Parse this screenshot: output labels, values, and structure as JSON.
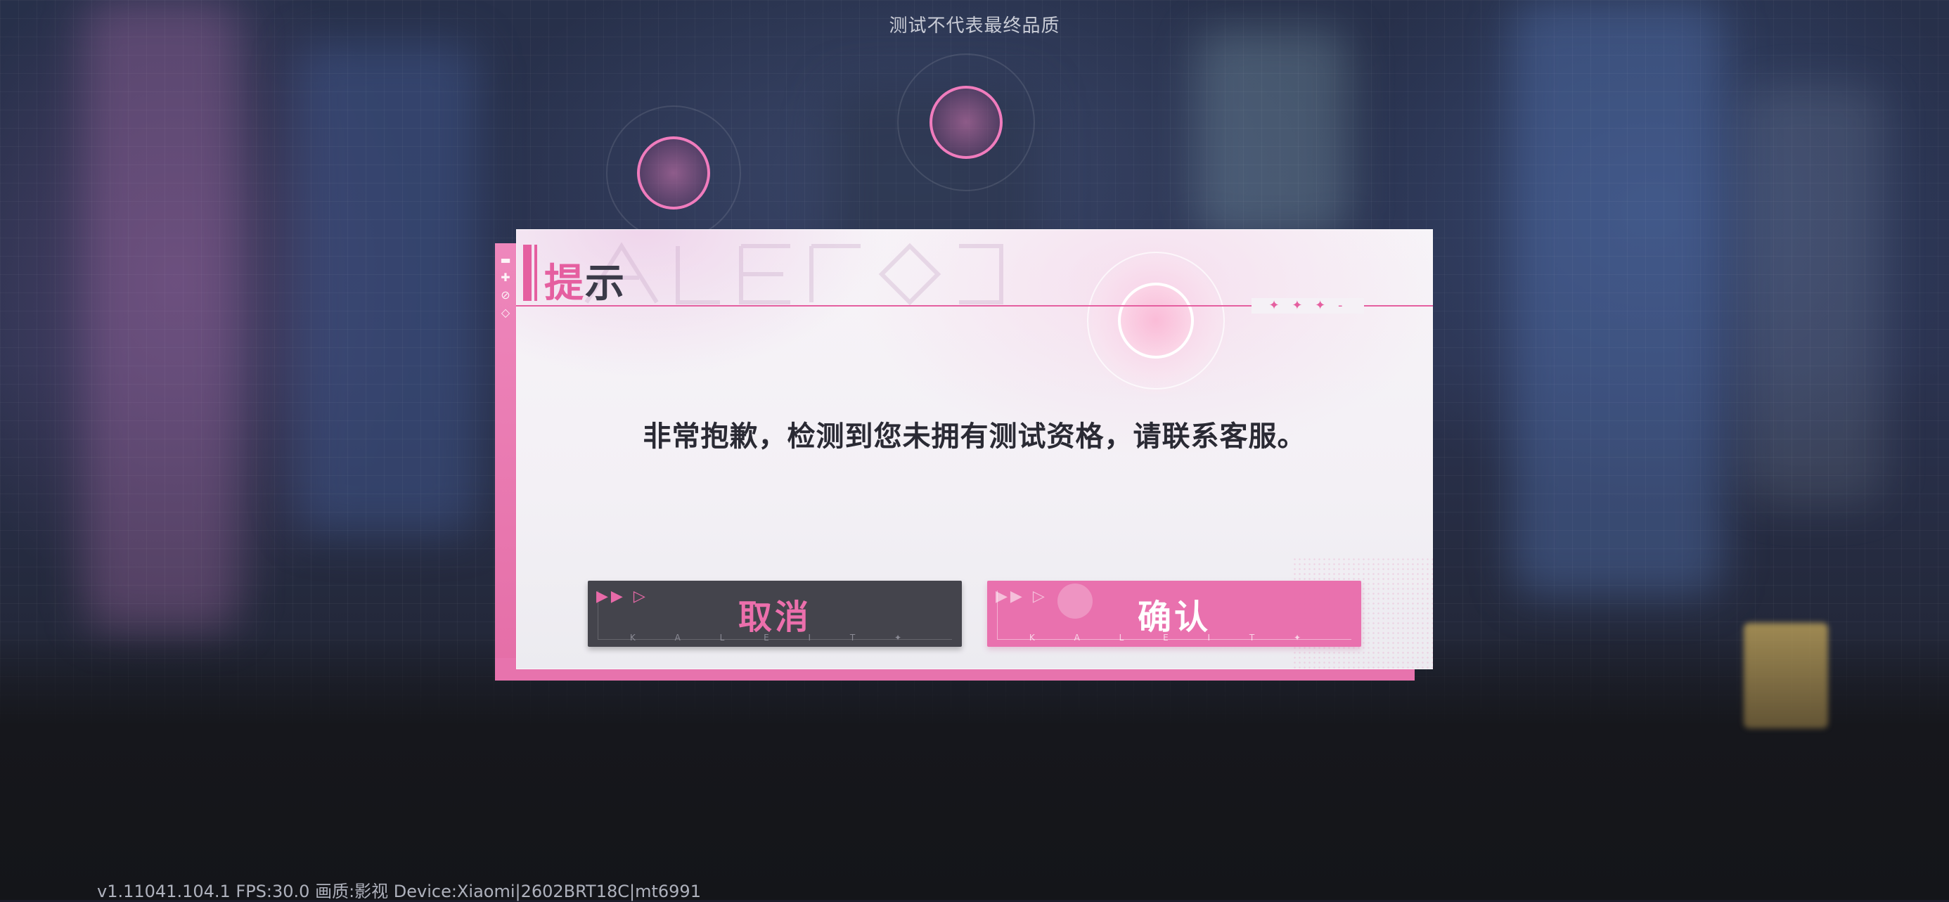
{
  "top_notice": "测试不代表最终品质",
  "dialog": {
    "title_accent": "提",
    "title_rest": "示",
    "title_line_marks": "✦ ✦  ✦ -",
    "message": "非常抱歉，检测到您未拥有测试资格，请联系客服。",
    "cancel_label": "取消",
    "confirm_label": "确认",
    "button_sub_text": "K A L E I T ✦",
    "button_triangles": "▶▶ ▷"
  },
  "footer": {
    "build_info": "v1.11041.104.1 FPS:30.0 画质:影视 Device:Xiaomi|2602BRT18C|mt6991"
  },
  "colors": {
    "accent_pink": "#e55fa0",
    "button_dark": "#44444c",
    "button_pink": "#e971ae"
  },
  "icons": [
    "selection-ring-icon",
    "triangle-play-icon",
    "dialog-spine-icon"
  ]
}
